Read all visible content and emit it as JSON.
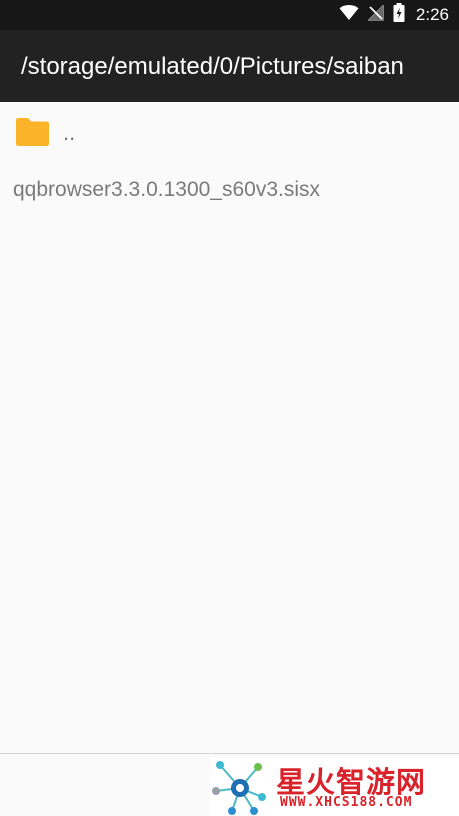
{
  "status_bar": {
    "time": "2:26",
    "icons": [
      "wifi-icon",
      "no-signal-icon",
      "battery-charging-icon"
    ]
  },
  "app_bar": {
    "path": "/storage/emulated/0/Pictures/saiban"
  },
  "file_list": {
    "parent": {
      "icon": "folder-icon",
      "label": ".."
    },
    "items": [
      {
        "name": "qqbrowser3.3.0.1300_s60v3.sisx"
      }
    ]
  },
  "watermark": {
    "title": "星火智游网",
    "url": "WWW.XHCS188.COM"
  },
  "colors": {
    "status_bar": "#171717",
    "app_bar": "#222222",
    "background": "#fafafa",
    "folder": "#fbb42a",
    "watermark": "#d9222a"
  }
}
